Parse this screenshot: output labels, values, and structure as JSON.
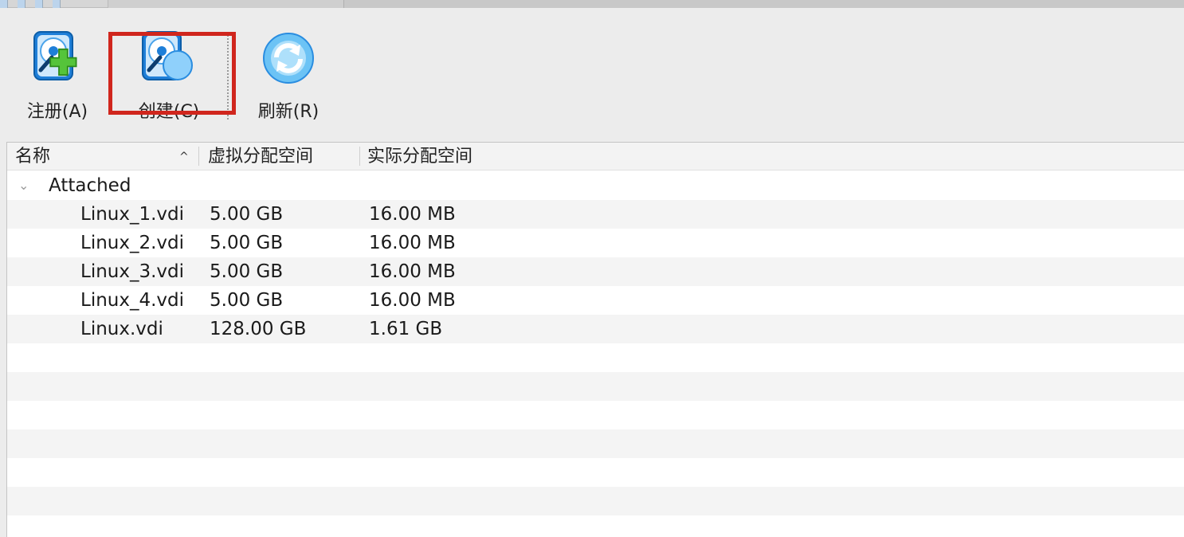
{
  "toolbar": {
    "register_label": "注册(A)",
    "create_label": "创建(C)",
    "refresh_label": "刷新(R)"
  },
  "table": {
    "columns": {
      "name": "名称",
      "virtual_size": "虚拟分配空间",
      "actual_size": "实际分配空间"
    },
    "sort_indicator": "^",
    "group": {
      "label": "Attached",
      "expand_icon": "chevron-down-icon"
    },
    "rows": [
      {
        "name": "Linux_1.vdi",
        "virtual_size": "5.00 GB",
        "actual_size": "16.00 MB"
      },
      {
        "name": "Linux_2.vdi",
        "virtual_size": "5.00 GB",
        "actual_size": "16.00 MB"
      },
      {
        "name": "Linux_3.vdi",
        "virtual_size": "5.00 GB",
        "actual_size": "16.00 MB"
      },
      {
        "name": "Linux_4.vdi",
        "virtual_size": "5.00 GB",
        "actual_size": "16.00 MB"
      },
      {
        "name": "Linux.vdi",
        "virtual_size": "128.00 GB",
        "actual_size": "1.61 GB"
      }
    ]
  },
  "colors": {
    "highlight": "#d0261d",
    "icon_blue": "#2a8de0",
    "icon_green": "#43b02a"
  }
}
